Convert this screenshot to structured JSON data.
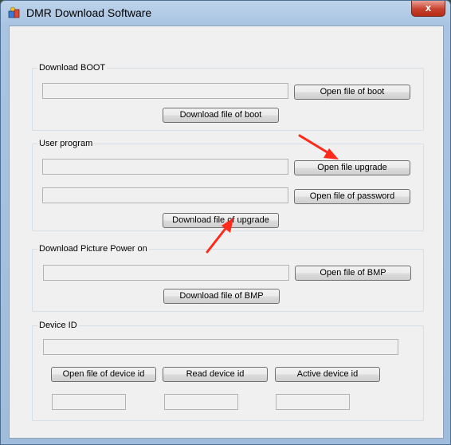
{
  "window": {
    "title": "DMR Download Software",
    "close_label": "x"
  },
  "boot": {
    "label": "Download BOOT",
    "open_button": "Open file of boot",
    "download_button": "Download file of boot"
  },
  "user": {
    "label": "User program",
    "open_upgrade_button": "Open file upgrade",
    "open_password_button": "Open file of password",
    "download_button": "Download file of upgrade"
  },
  "picture": {
    "label": "Download Picture Power on",
    "open_button": "Open file of BMP",
    "download_button": "Download file of BMP"
  },
  "device": {
    "label": "Device ID",
    "open_button": "Open file of device id",
    "read_button": "Read device id",
    "active_button": "Active device id"
  },
  "colors": {
    "annotation_arrow": "#ff2a1a"
  }
}
